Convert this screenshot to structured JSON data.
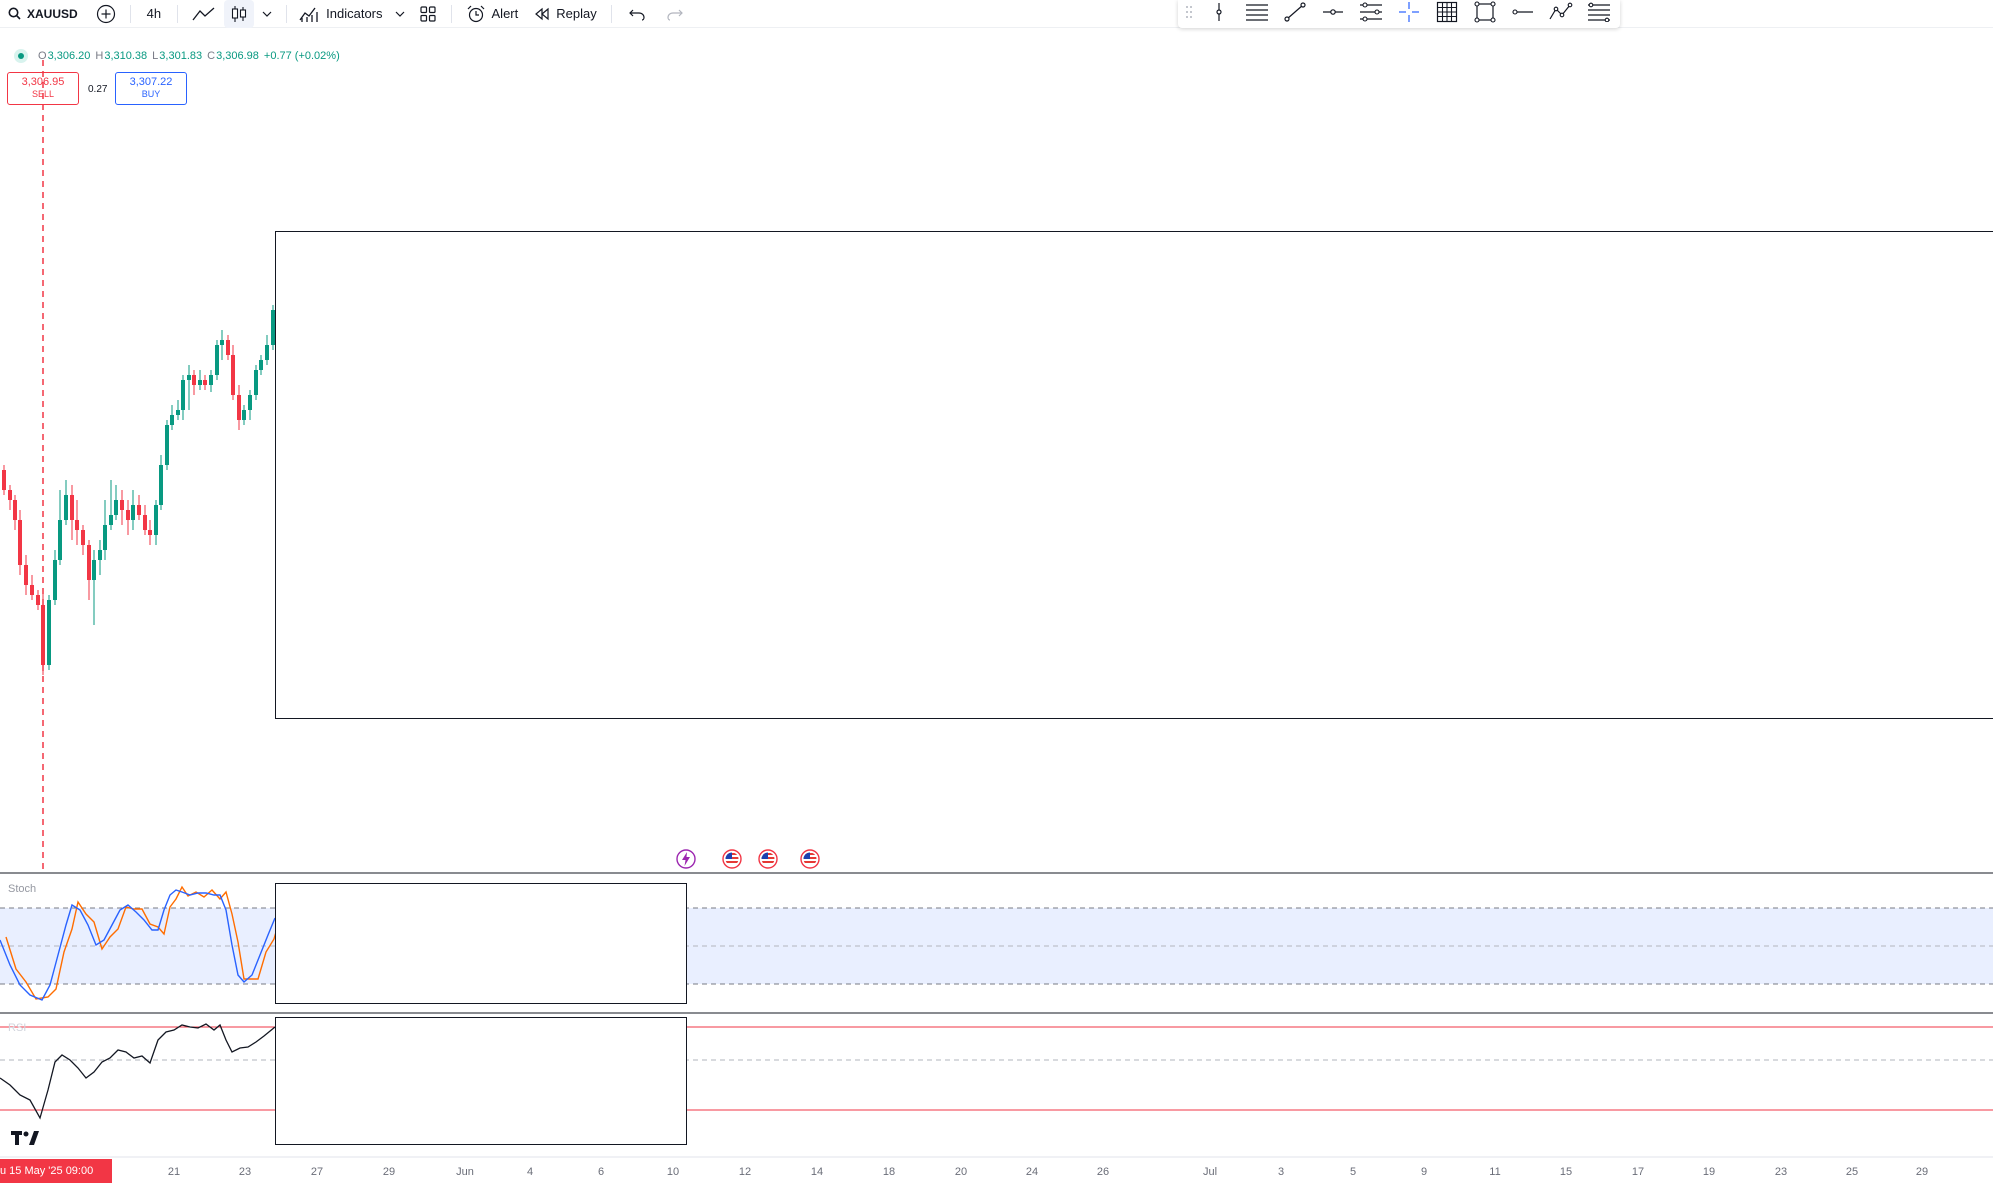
{
  "toolbar": {
    "symbol": "XAUUSD",
    "interval": "4h",
    "indicators_label": "Indicators",
    "alert_label": "Alert",
    "replay_label": "Replay"
  },
  "legend": {
    "open_label": "O",
    "open": "3,306.20",
    "high_label": "H",
    "high": "3,310.38",
    "low_label": "L",
    "low": "3,301.83",
    "close_label": "C",
    "close": "3,306.98",
    "change": "+0.77 (+0.02%)"
  },
  "trade": {
    "sell_price": "3,306.95",
    "sell_label": "SELL",
    "spread": "0.27",
    "buy_price": "3,307.22",
    "buy_label": "BUY"
  },
  "panes": {
    "stoch_label": "Stoch",
    "rsi_label": "RSI"
  },
  "time_axis": {
    "crosshair_label": "u 15 May '25   09:00",
    "labels": [
      "21",
      "23",
      "27",
      "29",
      "Jun",
      "4",
      "6",
      "10",
      "12",
      "14",
      "18",
      "20",
      "24",
      "26",
      "Jul",
      "3",
      "5",
      "9",
      "11",
      "15",
      "17",
      "19",
      "23",
      "25",
      "29"
    ]
  },
  "colors": {
    "up": "#089981",
    "down": "#f23645",
    "stoch_k": "#2962ff",
    "stoch_d": "#ff6d00",
    "accent": "#2962ff"
  },
  "chart_data": {
    "type": "candlestick",
    "symbol": "XAUUSD",
    "interval": "4h",
    "last_ohlc": {
      "open": 3306.2,
      "high": 3310.38,
      "low": 3301.83,
      "close": 3306.98
    },
    "indicators": [
      "Stoch",
      "RSI"
    ]
  }
}
